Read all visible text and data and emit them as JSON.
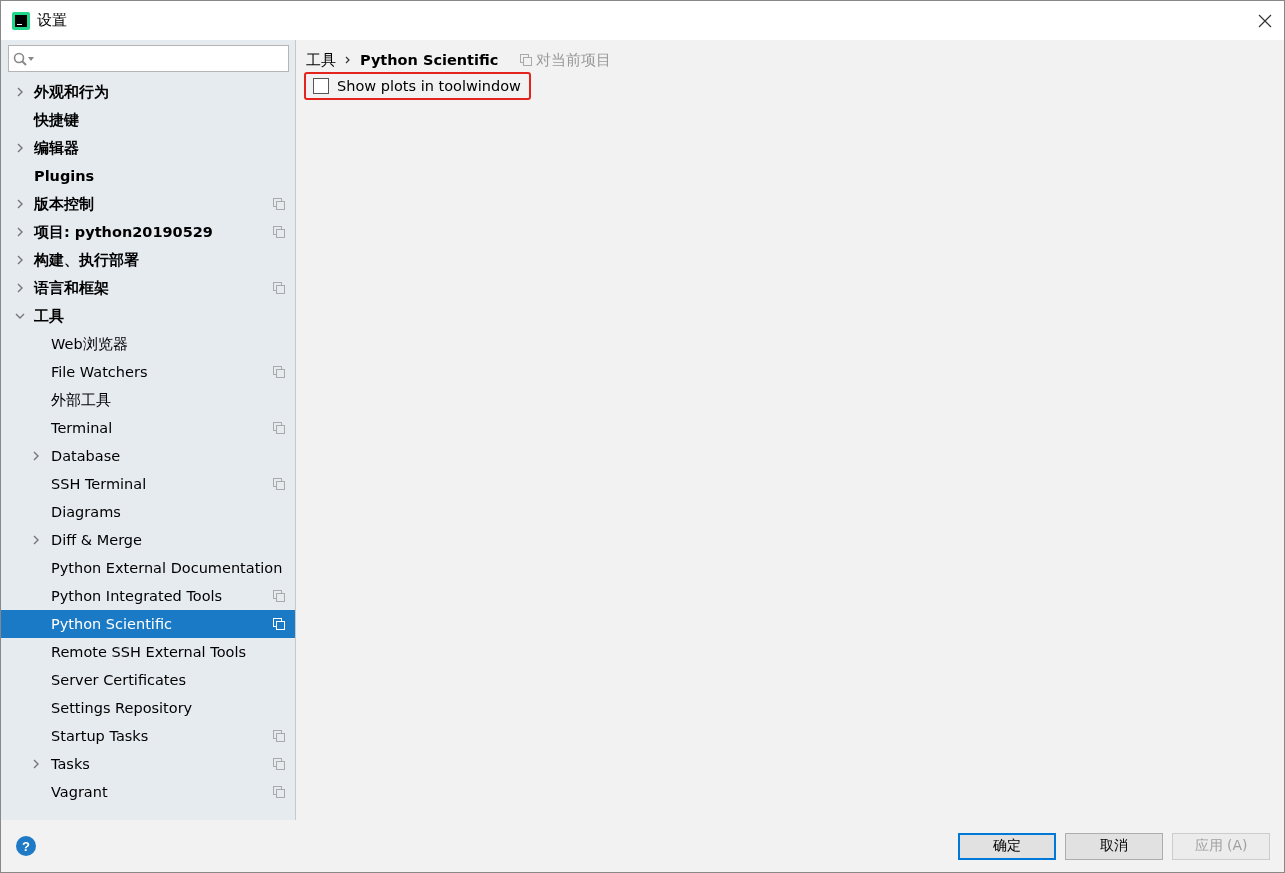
{
  "window": {
    "title": "设置"
  },
  "help": {
    "label": "?"
  },
  "sidebar": {
    "items": [
      {
        "label": "外观和行为",
        "expanded": false,
        "project_scope": false,
        "selected": false
      },
      {
        "label": "快捷键",
        "project_scope": false,
        "selected": false
      },
      {
        "label": "编辑器",
        "expanded": false,
        "project_scope": false,
        "selected": false
      },
      {
        "label": "Plugins",
        "project_scope": false,
        "selected": false
      },
      {
        "label": "版本控制",
        "expanded": false,
        "project_scope": true,
        "selected": false
      },
      {
        "label": "项目: python20190529",
        "expanded": false,
        "project_scope": true,
        "selected": false
      },
      {
        "label": "构建、执行部署",
        "expanded": false,
        "project_scope": false,
        "selected": false
      },
      {
        "label": "语言和框架",
        "expanded": false,
        "project_scope": true,
        "selected": false
      },
      {
        "label": "工具",
        "expanded": true,
        "project_scope": false,
        "selected": false,
        "children": [
          {
            "label": "Web浏览器",
            "project_scope": false,
            "selected": false
          },
          {
            "label": "File Watchers",
            "project_scope": true,
            "selected": false
          },
          {
            "label": "外部工具",
            "project_scope": false,
            "selected": false
          },
          {
            "label": "Terminal",
            "project_scope": true,
            "selected": false
          },
          {
            "label": "Database",
            "expanded": false,
            "project_scope": false,
            "selected": false
          },
          {
            "label": "SSH Terminal",
            "project_scope": true,
            "selected": false
          },
          {
            "label": "Diagrams",
            "project_scope": false,
            "selected": false
          },
          {
            "label": "Diff & Merge",
            "expanded": false,
            "project_scope": false,
            "selected": false
          },
          {
            "label": "Python External Documentation",
            "project_scope": false,
            "selected": false
          },
          {
            "label": "Python Integrated Tools",
            "project_scope": true,
            "selected": false
          },
          {
            "label": "Python Scientific",
            "project_scope": true,
            "selected": true
          },
          {
            "label": "Remote SSH External Tools",
            "project_scope": false,
            "selected": false
          },
          {
            "label": "Server Certificates",
            "project_scope": false,
            "selected": false
          },
          {
            "label": "Settings Repository",
            "project_scope": false,
            "selected": false
          },
          {
            "label": "Startup Tasks",
            "project_scope": true,
            "selected": false
          },
          {
            "label": "Tasks",
            "expanded": false,
            "project_scope": true,
            "selected": false
          },
          {
            "label": "Vagrant",
            "project_scope": true,
            "selected": false
          }
        ]
      }
    ]
  },
  "breadcrumb": {
    "parent": "工具",
    "current": "Python Scientific",
    "scope_note": "对当前项目"
  },
  "options": [
    {
      "label": "Show plots in toolwindow",
      "checked": false,
      "highlighted": true
    }
  ],
  "buttons": [
    {
      "label": "确定",
      "kind": "default"
    },
    {
      "label": "取消",
      "kind": "normal"
    },
    {
      "label": "应用 (A)",
      "kind": "disabled"
    }
  ]
}
